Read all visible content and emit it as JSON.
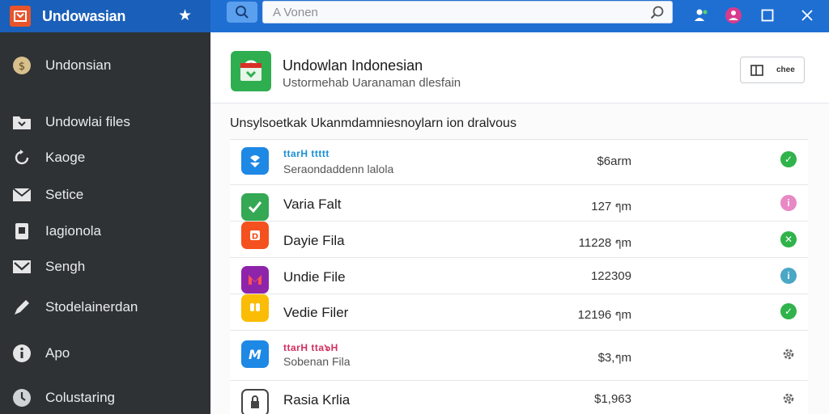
{
  "window": {
    "title": "Undowasian"
  },
  "search": {
    "placeholder": "A Vonen"
  },
  "sidebar": {
    "items": [
      {
        "label": "Undonsian",
        "icon": "coin-icon"
      },
      {
        "label": "Undowlai files",
        "icon": "download-folder-icon"
      },
      {
        "label": "Kaoge",
        "icon": "refresh-icon"
      },
      {
        "label": "Setice",
        "icon": "mail-icon"
      },
      {
        "label": "Iagionola",
        "icon": "tablet-icon"
      },
      {
        "label": "Sengh",
        "icon": "envelope-icon"
      },
      {
        "label": "Stodelainerdan",
        "icon": "pen-icon"
      },
      {
        "label": "Apo",
        "icon": "info-icon"
      },
      {
        "label": "Colustaring",
        "icon": "clock-icon"
      }
    ]
  },
  "header": {
    "title": "Undowlan Indonesian",
    "subtitle": "Ustormehab Uaranaman dlesfain",
    "view_button_label": "chee"
  },
  "section": {
    "heading": "Unsylsoetkak Ukanmdamniesnoylarn ion dralvous"
  },
  "files": [
    {
      "tags": "ttarH ttttt",
      "name": "",
      "desc": "Seraondaddenn lalola",
      "size": "$6arm",
      "status": "check",
      "icon_color": "#1e88e5"
    },
    {
      "tags": "",
      "name": "Varia Falt",
      "desc": "",
      "size": "127 ๆm",
      "status": "info",
      "icon_color": "#34a853"
    },
    {
      "tags": "",
      "name": "Dayie Fila",
      "desc": "",
      "size": "11228 ๆm",
      "status": "cross",
      "icon_color": "#f4511e"
    },
    {
      "tags": "",
      "name": "Undie File",
      "desc": "",
      "size": "122309",
      "status": "info",
      "icon_color": "#8e24aa"
    },
    {
      "tags": "",
      "name": "Vedie Filer",
      "desc": "",
      "size": "12196 ๆm",
      "status": "check",
      "icon_color": "#fbbc05"
    },
    {
      "tags": "ttarH tta๖H",
      "name": "",
      "desc": "Sobenan Fila",
      "size": "$3,ๆm",
      "status": "gear",
      "icon_color": "#1e88e5"
    },
    {
      "tags": "",
      "name": "Rasia Krlia",
      "desc": "",
      "size": "$1,963",
      "status": "gear",
      "icon_color": "#444444"
    }
  ],
  "colors": {
    "titlebar": "#1f6fd3",
    "sidebar": "#2f3235",
    "accent_green": "#2fae4f",
    "status_check": "#2fb34a",
    "status_info_pink": "#e889c4",
    "status_info_teal": "#4aa7c6"
  }
}
